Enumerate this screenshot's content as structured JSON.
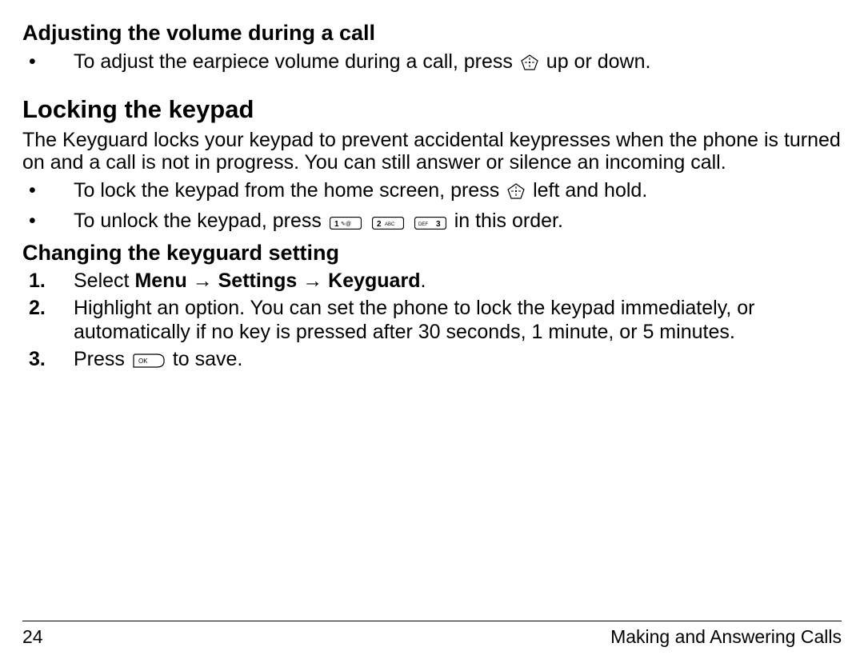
{
  "sec1": {
    "heading": "Adjusting the volume during a call",
    "bullet1a": "To adjust the earpiece volume during a call, press ",
    "bullet1b": " up or down."
  },
  "sec2": {
    "heading": "Locking the keypad",
    "intro": "The Keyguard locks your keypad to prevent accidental keypresses when the phone is turned on and a call is not in progress. You can still answer or silence an incoming call.",
    "bullet1a": "To lock the keypad from the home screen, press ",
    "bullet1b": " left and hold.",
    "bullet2a": "To unlock the keypad, press ",
    "bullet2b": " in this order."
  },
  "sec3": {
    "heading": "Changing the keyguard setting",
    "step1a": "Select ",
    "step1b": "Menu",
    "arrow": " → ",
    "step1c": "Settings",
    "step1d": "Keyguard",
    "period": ".",
    "step2": "Highlight an option. You can set the phone to lock the keypad immediately, or automatically if no key is pressed after 30 seconds, 1 minute, or 5 minutes.",
    "step3a": "Press ",
    "step3b": " to save.",
    "m1": "1.",
    "m2": "2.",
    "m3": "3."
  },
  "footer": {
    "page": "24",
    "chapter": "Making and Answering Calls"
  },
  "icons": {
    "nav": "nav-pad-icon",
    "k1": "key-1-icon",
    "k2": "key-2-icon",
    "k3": "key-3-icon",
    "ok": "ok-key-icon"
  }
}
